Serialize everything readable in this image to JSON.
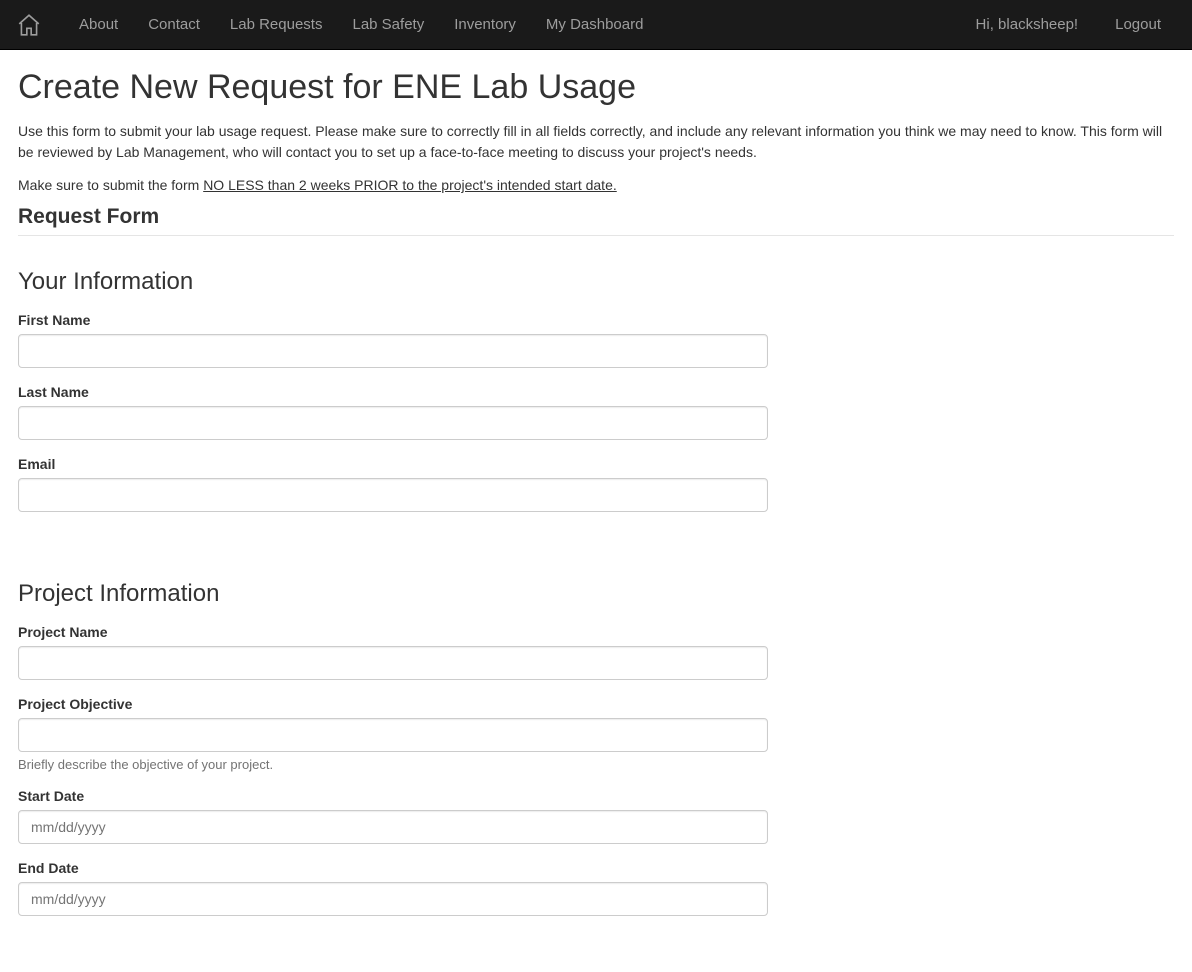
{
  "nav": {
    "items": [
      {
        "label": "About"
      },
      {
        "label": "Contact"
      },
      {
        "label": "Lab Requests"
      },
      {
        "label": "Lab Safety"
      },
      {
        "label": "Inventory"
      },
      {
        "label": "My Dashboard"
      }
    ],
    "greeting": "Hi, blacksheep!",
    "logout": "Logout"
  },
  "page": {
    "title": "Create New Request for ENE Lab Usage",
    "intro": "Use this form to submit your lab usage request. Please make sure to correctly fill in all fields correctly, and include any relevant information you think we may need to know. This form will be reviewed by Lab Management, who will contact you to set up a face-to-face meeting to discuss your project's needs.",
    "deadline_prefix": "Make sure to submit the form ",
    "deadline_underlined": "NO LESS than 2 weeks PRIOR to the project's intended start date.",
    "legend": "Request Form"
  },
  "sections": {
    "your_info": {
      "header": "Your Information",
      "first_name_label": "First Name",
      "last_name_label": "Last Name",
      "email_label": "Email"
    },
    "project_info": {
      "header": "Project Information",
      "project_name_label": "Project Name",
      "project_objective_label": "Project Objective",
      "project_objective_help": "Briefly describe the objective of your project.",
      "start_date_label": "Start Date",
      "start_date_placeholder": "mm/dd/yyyy",
      "end_date_label": "End Date",
      "end_date_placeholder": "mm/dd/yyyy"
    }
  }
}
